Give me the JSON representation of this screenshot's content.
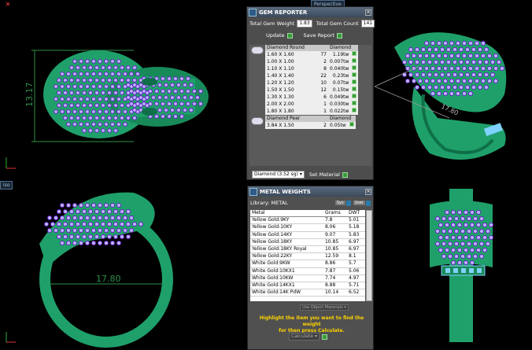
{
  "viewports": {
    "top_center_tab": "Perspective",
    "bottom_left_tab": "iso"
  },
  "dimensions": {
    "front_height": "13.17",
    "side_length": "17.80",
    "ring_inner": "17.80"
  },
  "gem_reporter": {
    "title": "GEM REPORTER",
    "total_weight_label": "Total Gem Weight",
    "total_weight_value": "1.83",
    "total_count_label": "Total Gem Count",
    "total_count_value": "141",
    "update_label": "Update",
    "save_report_label": "Save Report",
    "groups": [
      {
        "name": "Diamond Round",
        "material": "Diamond",
        "rows": [
          {
            "size": "1.60 X 1.60",
            "count": "77",
            "weight": "1.19tw"
          },
          {
            "size": "1.00 X 1.00",
            "count": "2",
            "weight": "0.007tw"
          },
          {
            "size": "1.10 X 1.10",
            "count": "8",
            "weight": "0.040tw"
          },
          {
            "size": "1.40 X 1.40",
            "count": "22",
            "weight": "0.23tw"
          },
          {
            "size": "1.20 X 1.20",
            "count": "10",
            "weight": "0.07tw"
          },
          {
            "size": "1.50 X 1.50",
            "count": "12",
            "weight": "0.15tw"
          },
          {
            "size": "1.30 X 1.30",
            "count": "6",
            "weight": "0.049tw"
          },
          {
            "size": "2.00 X 2.00",
            "count": "1",
            "weight": "0.030tw"
          },
          {
            "size": "1.80 X 1.80",
            "count": "1",
            "weight": "0.022tw"
          }
        ]
      },
      {
        "name": "Diamond Pear",
        "material": "Diamond",
        "rows": [
          {
            "size": "3.84 X 1.50",
            "count": "2",
            "weight": "0.05tw"
          }
        ]
      }
    ],
    "material_select": "Diamond",
    "material_density": "(3.52 sg)",
    "set_material_label": "Set Material"
  },
  "metal_weights": {
    "title": "METAL WEIGHTS",
    "library_label": "Library: METAL",
    "sys_label": "Sys",
    "user_label": "User",
    "col_metal": "Metal",
    "col_grams": "Grams",
    "col_dwt": "DWT",
    "rows": [
      {
        "metal": "Yellow Gold:9KY",
        "grams": "7.8",
        "dwt": "5.01"
      },
      {
        "metal": "Yellow Gold:10KY",
        "grams": "8.06",
        "dwt": "5.18"
      },
      {
        "metal": "Yellow Gold:14KY",
        "grams": "9.07",
        "dwt": "5.83"
      },
      {
        "metal": "Yellow Gold:18KY",
        "grams": "10.85",
        "dwt": "6.97"
      },
      {
        "metal": "Yellow Gold:18KY Royal",
        "grams": "10.85",
        "dwt": "6.97"
      },
      {
        "metal": "Yellow Gold:22KY",
        "grams": "12.59",
        "dwt": "8.1"
      },
      {
        "metal": "White Gold:9KW",
        "grams": "8.86",
        "dwt": "5.7"
      },
      {
        "metal": "White Gold:10KX1",
        "grams": "7.87",
        "dwt": "5.06"
      },
      {
        "metal": "White Gold:10KW",
        "grams": "7.74",
        "dwt": "4.97"
      },
      {
        "metal": "White Gold:14KX1",
        "grams": "8.88",
        "dwt": "5.71"
      },
      {
        "metal": "White Gold:14K PdW",
        "grams": "10.14",
        "dwt": "6.52"
      }
    ],
    "use_object_materials": "Use Object Materials",
    "hint_line1": "Highlight the item you want to find the weight",
    "hint_line2": "for then press Calculate.",
    "calculate_label": "Calculate"
  },
  "colors": {
    "metal": "#1fa06a",
    "gem": "#b9b6ff",
    "prong": "#6a1fc4",
    "dimension": "#2f8f4a"
  }
}
